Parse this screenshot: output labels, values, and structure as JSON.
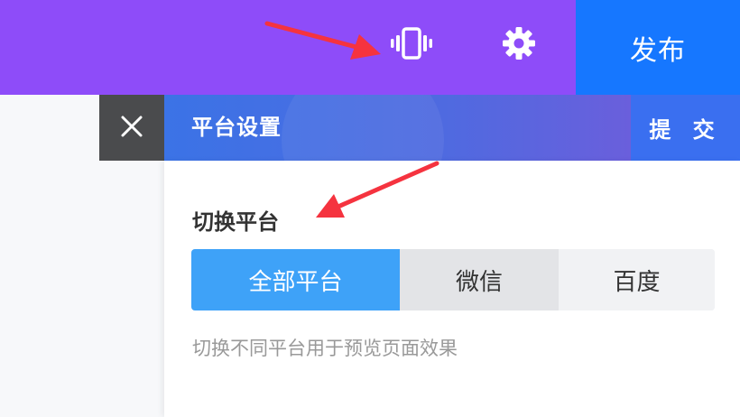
{
  "topbar": {
    "publish_label": "发布",
    "icons": [
      "phone-vibrate-icon",
      "gear-icon"
    ]
  },
  "panel": {
    "title": "平台设置",
    "submit_label": "提 交",
    "close_icon": "close-icon",
    "section_title": "切换平台",
    "options": [
      {
        "label": "全部平台",
        "selected": true
      },
      {
        "label": "微信",
        "selected": false
      },
      {
        "label": "百度",
        "selected": false
      }
    ],
    "hint": "切换不同平台用于预览页面效果"
  },
  "colors": {
    "topbar": "#8e4cf9",
    "publish": "#1677ff",
    "selected": "#3ea2f8",
    "arrow": "#f5333f"
  }
}
